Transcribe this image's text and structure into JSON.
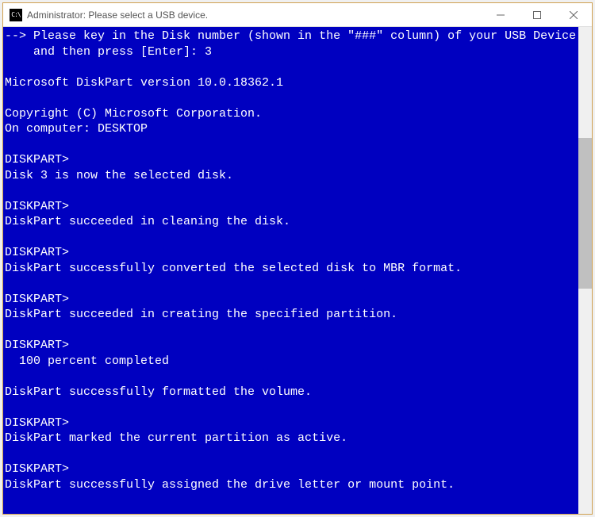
{
  "titlebar": {
    "icon_text": "C:\\",
    "title": "Administrator:   Please select a USB device."
  },
  "console": {
    "lines": [
      "--> Please key in the Disk number (shown in the \"###\" column) of your USB Device",
      "    and then press [Enter]: 3",
      "",
      "Microsoft DiskPart version 10.0.18362.1",
      "",
      "Copyright (C) Microsoft Corporation.",
      "On computer: DESKTOP",
      "",
      "DISKPART>",
      "Disk 3 is now the selected disk.",
      "",
      "DISKPART>",
      "DiskPart succeeded in cleaning the disk.",
      "",
      "DISKPART>",
      "DiskPart successfully converted the selected disk to MBR format.",
      "",
      "DISKPART>",
      "DiskPart succeeded in creating the specified partition.",
      "",
      "DISKPART>",
      "  100 percent completed",
      "",
      "DiskPart successfully formatted the volume.",
      "",
      "DISKPART>",
      "DiskPart marked the current partition as active.",
      "",
      "DISKPART>",
      "DiskPart successfully assigned the drive letter or mount point.",
      ""
    ]
  }
}
